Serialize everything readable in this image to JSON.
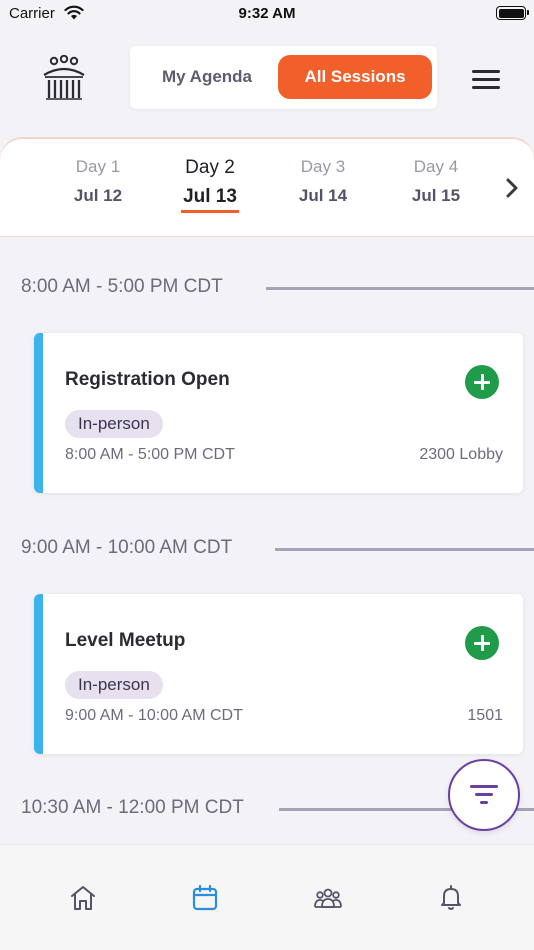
{
  "status_bar": {
    "carrier": "Carrier",
    "time": "9:32 AM"
  },
  "header": {
    "logo_icon": "building-people-logo",
    "tabs": [
      {
        "label": "My Agenda",
        "active": false
      },
      {
        "label": "All Sessions",
        "active": true
      }
    ],
    "menu_icon": "hamburger-menu-icon"
  },
  "days": [
    {
      "label": "Day 1",
      "date": "Jul 12",
      "active": false
    },
    {
      "label": "Day 2",
      "date": "Jul 13",
      "active": true
    },
    {
      "label": "Day 3",
      "date": "Jul 14",
      "active": false
    },
    {
      "label": "Day 4",
      "date": "Jul 15",
      "active": false
    }
  ],
  "time_groups": [
    {
      "time": "8:00 AM - 5:00 PM CDT",
      "session": {
        "title": "Registration Open",
        "format": "In-person",
        "time": "8:00 AM - 5:00 PM CDT",
        "room": "2300 Lobby"
      }
    },
    {
      "time": "9:00 AM - 10:00 AM CDT",
      "session": {
        "title": "Level Meetup",
        "format": "In-person",
        "time": "9:00 AM - 10:00 AM CDT",
        "room": "1501"
      }
    },
    {
      "time": "10:30 AM - 12:00 PM CDT"
    }
  ],
  "bottom_nav": [
    {
      "icon": "home-icon",
      "active": false
    },
    {
      "icon": "calendar-icon",
      "active": true
    },
    {
      "icon": "people-icon",
      "active": false
    },
    {
      "icon": "bell-icon",
      "active": false
    }
  ],
  "colors": {
    "accent": "#f1602a",
    "card_stripe": "#3db3ee",
    "add_button": "#1f9b49",
    "filter": "#6b3fa0",
    "nav_active": "#2a8fd8"
  }
}
